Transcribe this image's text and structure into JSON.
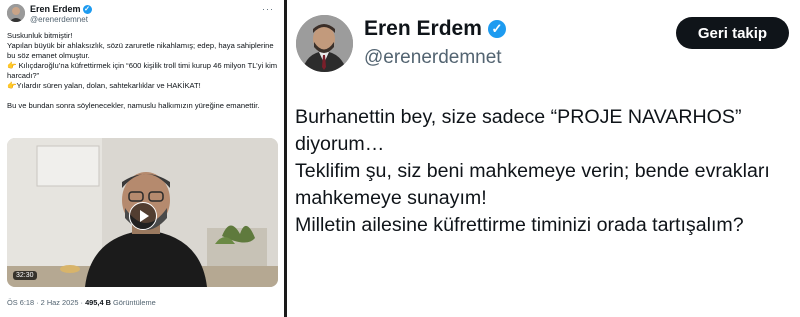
{
  "left_tweet": {
    "author_name": "Eren Erdem",
    "author_handle": "@erenerdemnet",
    "more_icon": "more-dots-icon",
    "lines": [
      "Suskunluk bitmiştir!",
      "Yapılan büyük bir ahlaksızlık, sözü zaruretle nikahlamış; edep, haya sahiplerine bu söz emanet olmuştur.",
      "👉 Kılıçdaroğlu’na küfrettirmek için “600 kişilik troll timi kurup 46 milyon TL’yi kim harcadı?”",
      "👉Yılardır süren yalan, dolan, sahtekarlıklar ve HAKİKAT!",
      "",
      "Bu ve bundan sonra söylenecekler, namuslu halkımızın yüreğine emanettir."
    ],
    "video_duration": "32:30",
    "meta": {
      "time_date": "ÖS 6:18 · 2 Haz 2025 · ",
      "views": "495,4 B",
      "views_label": " Görüntüleme"
    }
  },
  "right_tweet": {
    "author_name": "Eren Erdem",
    "author_handle": "@erenerdemnet",
    "follow_button": "Geri takip",
    "paragraphs": [
      "Burhanettin bey, size sadece “PROJE NAVARHOS” diyorum…",
      "Teklifim şu, siz beni mahkemeye verin; bende evrakları mahkemeye sunayım!",
      "Milletin ailesine küfrettirme timinizi orada tartışalım?"
    ]
  },
  "colors": {
    "verified": "#1d9bf0",
    "text": "#0f1419",
    "secondary": "#536471"
  }
}
